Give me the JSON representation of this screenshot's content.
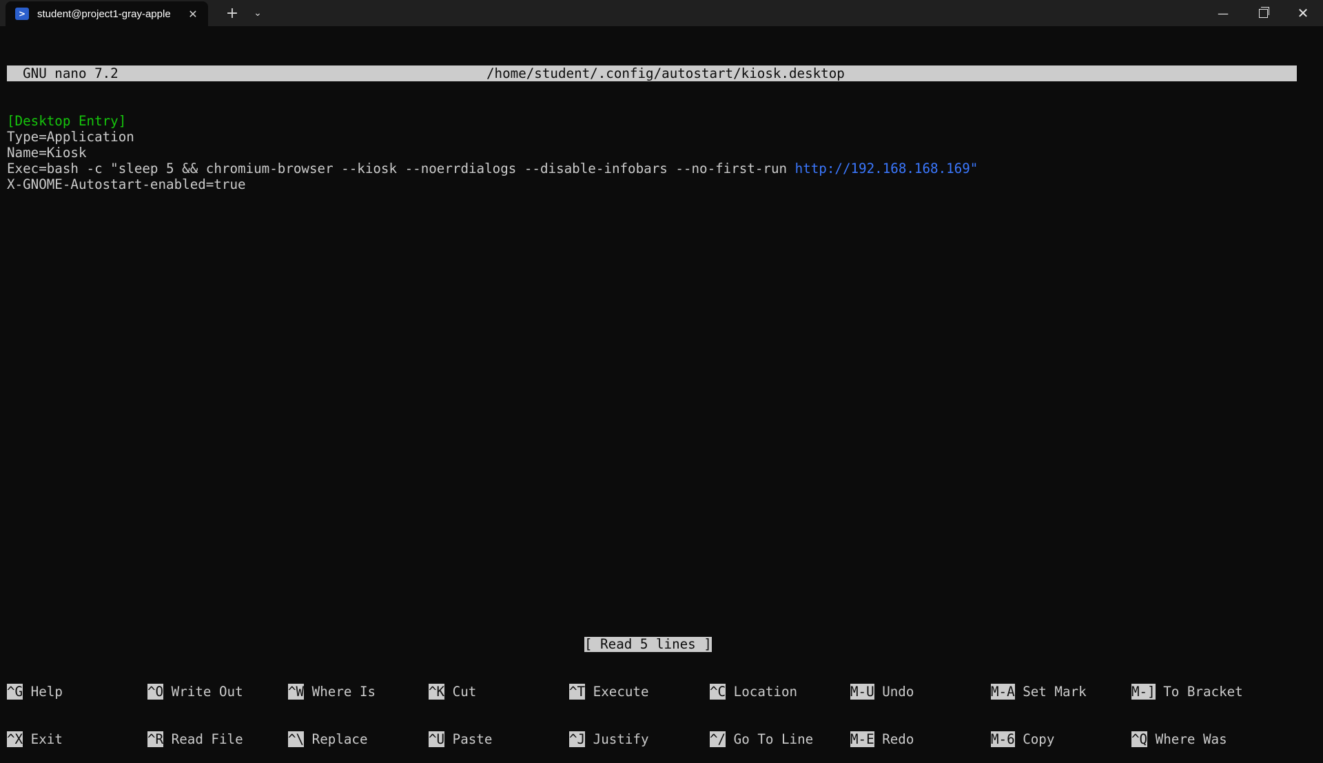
{
  "window": {
    "tab_title": "student@project1-gray-apple",
    "tab_icon": "powershell-icon",
    "new_tab_icon": "plus-icon",
    "tab_menu_icon": "chevron-down-icon",
    "minimize_icon": "minimize-icon",
    "maximize_icon": "restore-icon",
    "close_icon": "close-icon"
  },
  "nano": {
    "version": "  GNU nano 7.2",
    "file_path": "/home/student/.config/autostart/kiosk.desktop",
    "lines": [
      {
        "text": "[Desktop Entry]",
        "style": "section"
      },
      {
        "text": "Type=Application",
        "style": "plain"
      },
      {
        "text": "Name=Kiosk",
        "style": "plain"
      },
      {
        "text": "Exec=bash -c \"sleep 5 && chromium-browser --kiosk --noerrdialogs --disable-infobars --no-first-run ",
        "url": "http://192.168.168.169\"",
        "style": "exec"
      },
      {
        "text": "X-GNOME-Autostart-enabled=true",
        "style": "plain"
      }
    ],
    "status_message": "[ Read 5 lines ]",
    "shortcuts_row1": [
      {
        "key": "^G",
        "label": " Help"
      },
      {
        "key": "^O",
        "label": " Write Out"
      },
      {
        "key": "^W",
        "label": " Where Is"
      },
      {
        "key": "^K",
        "label": " Cut"
      },
      {
        "key": "^T",
        "label": " Execute"
      },
      {
        "key": "^C",
        "label": " Location"
      },
      {
        "key": "M-U",
        "label": " Undo"
      },
      {
        "key": "M-A",
        "label": " Set Mark"
      },
      {
        "key": "M-]",
        "label": " To Bracket"
      }
    ],
    "shortcuts_row2": [
      {
        "key": "^X",
        "label": " Exit"
      },
      {
        "key": "^R",
        "label": " Read File"
      },
      {
        "key": "^\\",
        "label": " Replace"
      },
      {
        "key": "^U",
        "label": " Paste"
      },
      {
        "key": "^J",
        "label": " Justify"
      },
      {
        "key": "^/",
        "label": " Go To Line"
      },
      {
        "key": "M-E",
        "label": " Redo"
      },
      {
        "key": "M-6",
        "label": " Copy"
      },
      {
        "key": "^Q",
        "label": " Where Was"
      }
    ]
  },
  "colors": {
    "background": "#0c0c0c",
    "foreground": "#cccccc",
    "section_header": "#16c60c",
    "url": "#3b78ff",
    "titlebar": "#202020"
  }
}
